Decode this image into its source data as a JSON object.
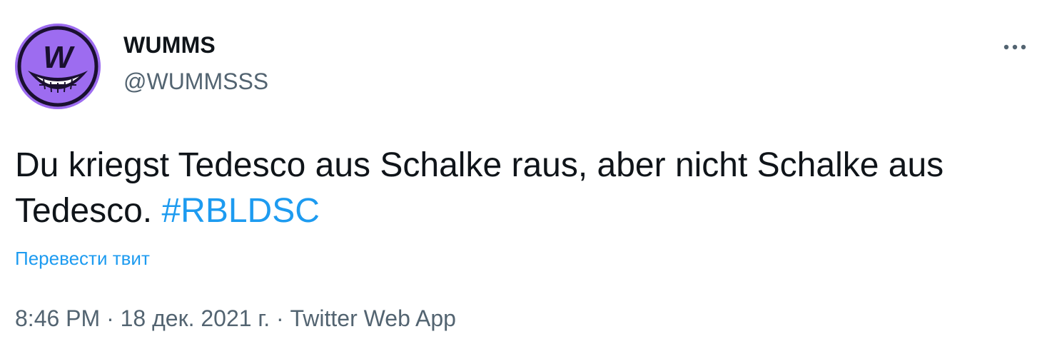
{
  "author": {
    "display_name": "WUMMS",
    "handle": "@WUMMSSS",
    "avatar_letter": "W",
    "avatar_color": "#9d6cf0"
  },
  "tweet": {
    "text_part1": "Du kriegst Tedesco aus Schalke raus, aber nicht Schalke aus Tedesco.",
    "hashtag": "#RBLDSC",
    "translate_label": "Перевести твит"
  },
  "meta": {
    "time": "8:46 PM",
    "date": "18 дек. 2021 г.",
    "source": "Twitter Web App",
    "separator": "·"
  },
  "colors": {
    "text": "#0f1419",
    "secondary": "#536471",
    "link": "#1d9bf0"
  },
  "icons": {
    "more": "more-horizontal-icon"
  }
}
